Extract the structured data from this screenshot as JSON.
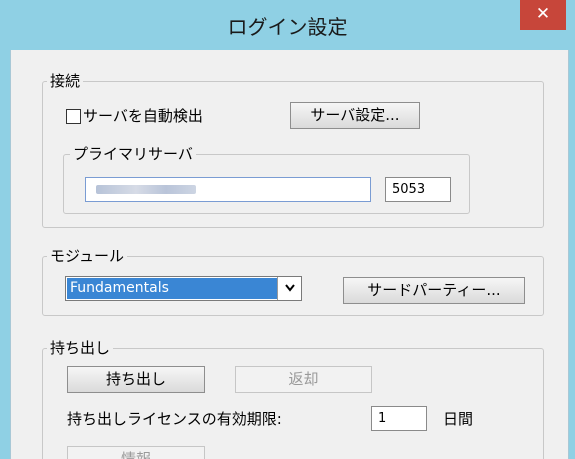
{
  "window": {
    "title": "ログイン設定",
    "close_glyph": "✕"
  },
  "connection": {
    "legend": "接続",
    "auto_detect_label": "サーバを自動検出",
    "auto_detect_checked": false,
    "server_settings_button": "サーバ設定...",
    "primary_server": {
      "legend": "プライマリサーバ",
      "port": "5053"
    }
  },
  "module": {
    "legend": "モジュール",
    "selected": "Fundamentals",
    "third_party_button": "サードパーティー..."
  },
  "checkout": {
    "legend": "持ち出し",
    "checkout_button": "持ち出し",
    "return_button": "返却",
    "expiry_label": "持ち出しライセンスの有効期限:",
    "expiry_value": "1",
    "expiry_unit": "日間",
    "info_button": "情報"
  },
  "icons": {
    "dropdown": "chevron-down-icon",
    "close": "close-icon"
  }
}
